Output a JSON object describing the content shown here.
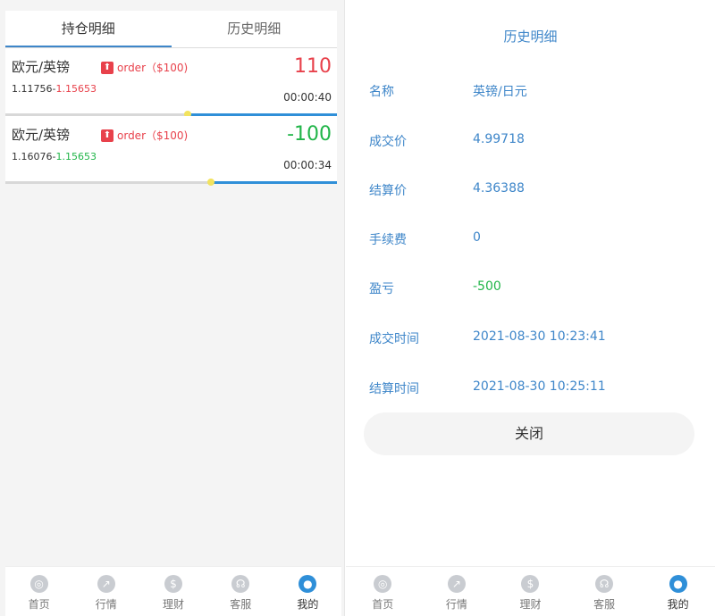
{
  "left": {
    "tabs": [
      {
        "label": "持仓明细",
        "active": true
      },
      {
        "label": "历史明细",
        "active": false
      }
    ],
    "positions": [
      {
        "pair": "欧元/英镑",
        "badge_icon": "up-arrow-icon",
        "badge": "⬆",
        "order": "order（$100)",
        "open_price": "1.11756",
        "current_price": "1.15653",
        "price_color": "red",
        "pnl": "110",
        "pnl_color": "red",
        "timer": "00:00:40",
        "progress": 0.55
      },
      {
        "pair": "欧元/英镑",
        "badge_icon": "up-arrow-icon",
        "badge": "⬆",
        "order": "order（$100)",
        "open_price": "1.16076",
        "current_price": "1.15653",
        "price_color": "green",
        "pnl": "-100",
        "pnl_color": "green",
        "timer": "00:00:34",
        "progress": 0.62
      }
    ]
  },
  "right": {
    "title": "历史明细",
    "rows": [
      {
        "label": "名称",
        "value": "英镑/日元"
      },
      {
        "label": "成交价",
        "value": "4.99718"
      },
      {
        "label": "结算价",
        "value": "4.36388"
      },
      {
        "label": "手续费",
        "value": "0"
      },
      {
        "label": "盈亏",
        "value": "-500",
        "value_color": "green"
      },
      {
        "label": "成交时间",
        "value": "2021-08-30 10:23:41"
      },
      {
        "label": "结算时间",
        "value": "2021-08-30 10:25:11"
      }
    ],
    "close_label": "关闭"
  },
  "nav": [
    {
      "label": "首页",
      "icon": "home-icon",
      "glyph": "◎",
      "active": false
    },
    {
      "label": "行情",
      "icon": "chart-icon",
      "glyph": "↗",
      "active": false
    },
    {
      "label": "理财",
      "icon": "finance-icon",
      "glyph": "$",
      "active": false
    },
    {
      "label": "客服",
      "icon": "headset-icon",
      "glyph": "☊",
      "active": false
    },
    {
      "label": "我的",
      "icon": "user-icon",
      "glyph": "●",
      "active": true
    }
  ],
  "colors": {
    "accent": "#3e86c9",
    "up": "#e8414b",
    "down": "#21b549",
    "progress": "#2f8fd8"
  }
}
